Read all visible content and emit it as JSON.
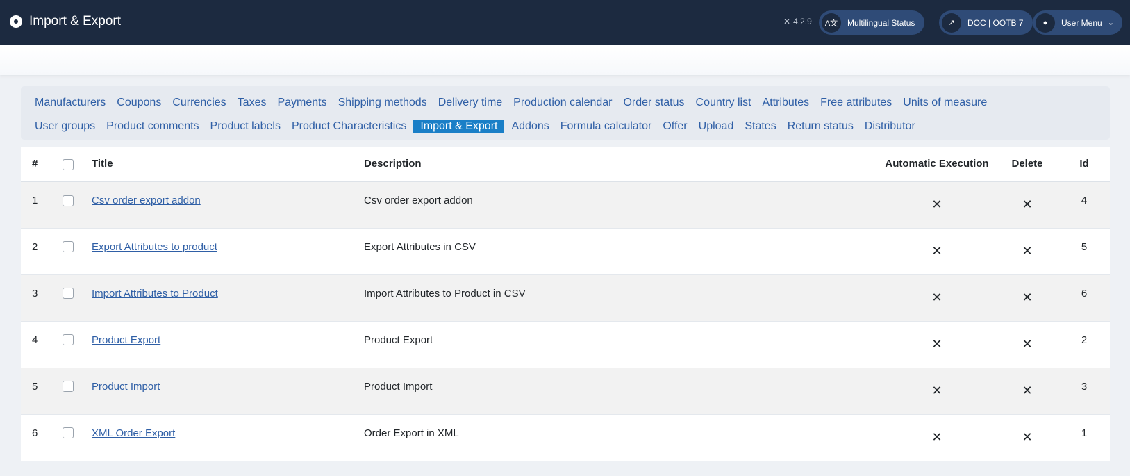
{
  "header": {
    "app_title": "Import & Export",
    "version": "4.2.9",
    "buttons": [
      {
        "label": "Multilingual Status",
        "icon": "language-icon"
      },
      {
        "label": "DOC | OOTB 7",
        "icon": "external-link-icon"
      },
      {
        "label": "User Menu",
        "icon": "user-icon"
      }
    ]
  },
  "nav": {
    "row1": [
      "Manufacturers",
      "Coupons",
      "Currencies",
      "Taxes",
      "Payments",
      "Shipping methods",
      "Delivery time",
      "Production calendar",
      "Order status",
      "Country list",
      "Attributes",
      "Free attributes",
      "Units of measure"
    ],
    "row2": [
      "User groups",
      "Product comments",
      "Product labels",
      "Product Characteristics",
      "Import & Export",
      "Addons",
      "Formula calculator",
      "Offer",
      "Upload",
      "States",
      "Return status",
      "Distributor"
    ],
    "active": "Import & Export"
  },
  "table": {
    "columns": {
      "num": "#",
      "title": "Title",
      "description": "Description",
      "automatic": "Automatic Execution",
      "delete": "Delete",
      "id": "Id"
    },
    "rows": [
      {
        "num": "1",
        "title": "Csv order export addon",
        "description": "Csv order export addon",
        "automatic": "✕",
        "delete": "✕",
        "id": "4"
      },
      {
        "num": "2",
        "title": "Export Attributes to product",
        "description": "Export Attributes in CSV",
        "automatic": "✕",
        "delete": "✕",
        "id": "5"
      },
      {
        "num": "3",
        "title": "Import Attributes to Product",
        "description": "Import Attributes to Product in CSV",
        "automatic": "✕",
        "delete": "✕",
        "id": "6"
      },
      {
        "num": "4",
        "title": "Product Export",
        "description": "Product Export",
        "automatic": "✕",
        "delete": "✕",
        "id": "2"
      },
      {
        "num": "5",
        "title": "Product Import",
        "description": "Product Import",
        "automatic": "✕",
        "delete": "✕",
        "id": "3"
      },
      {
        "num": "6",
        "title": "XML Order Export",
        "description": "Order Export in XML",
        "automatic": "✕",
        "delete": "✕",
        "id": "1"
      }
    ]
  },
  "colors": {
    "header_bg": "#1c2a40",
    "header_button_bg": "#2f4b77",
    "link": "#2f5fa6",
    "active_tab_bg": "#1a7fc7"
  }
}
